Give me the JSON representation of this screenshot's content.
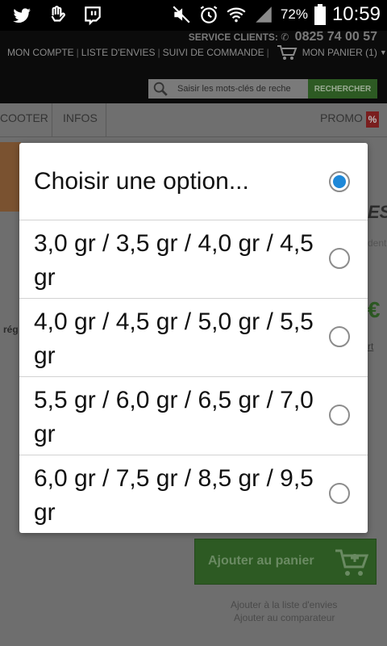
{
  "status_bar": {
    "battery_pct": "72%",
    "time": "10:59",
    "icons": [
      "twitter-icon",
      "hand-icon",
      "twitch-icon",
      "mute-icon",
      "alarm-icon",
      "wifi-icon",
      "signal-icon",
      "battery-icon"
    ]
  },
  "header": {
    "service_label": "SERVICE CLIENTS:",
    "service_phone": "0825 74 00 57",
    "nav": [
      "MON COMPTE",
      "LISTE D'ENVIES",
      "SUIVI DE COMMANDE"
    ],
    "cart_label": "MON PANIER (1)",
    "search_placeholder": "Saisir les mots-clés de reche",
    "search_button": "RECHERCHER"
  },
  "category_nav": {
    "items": [
      "COOTER",
      "INFOS"
    ],
    "promo_label": "PROMO",
    "promo_badge": "%"
  },
  "background": {
    "add_to_cart": "Ajouter au panier",
    "wishlist_link": "Ajouter à la liste d'envies",
    "compare_link": "Ajouter au comparateur",
    "fragments": [
      "ES",
      "dent",
      "€",
      "rég",
      "rt"
    ]
  },
  "dialog": {
    "options": [
      {
        "label": "Choisir une option...",
        "checked": true
      },
      {
        "label": "3,0 gr / 3,5 gr / 4,0 gr / 4,5 gr",
        "checked": false
      },
      {
        "label": "4,0 gr / 4,5 gr / 5,0 gr / 5,5 gr",
        "checked": false
      },
      {
        "label": "5,5 gr / 6,0 gr / 6,5 gr / 7,0 gr",
        "checked": false
      },
      {
        "label": "6,0 gr / 7,5 gr / 8,5 gr / 9,5 gr",
        "checked": false
      }
    ]
  },
  "colors": {
    "radio_checked": "#1e88d8",
    "brand_green": "#2d5a23",
    "promo_red": "#7a1e1e"
  }
}
